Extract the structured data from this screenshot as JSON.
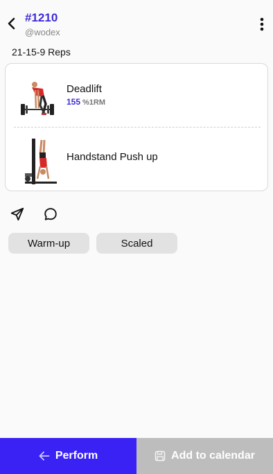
{
  "header": {
    "wod_id": "#1210",
    "author": "@wodex",
    "back_icon": "chevron-left-icon",
    "more_icon": "kebab-menu-icon"
  },
  "workout": {
    "scheme": "21-15-9 Reps",
    "exercises": [
      {
        "name": "Deadlift",
        "weight_value": "155",
        "weight_unit": "%1RM",
        "image": "deadlift-illustration"
      },
      {
        "name": "Handstand Push up",
        "image": "handstand-pushup-illustration"
      }
    ]
  },
  "actions": {
    "share_icon": "send-icon",
    "comment_icon": "comment-icon"
  },
  "tags": [
    "Warm-up",
    "Scaled"
  ],
  "footer": {
    "perform_label": "Perform",
    "calendar_label": "Add to calendar"
  },
  "colors": {
    "accent": "#3d2bd9",
    "perform_bg": "#3a22f5",
    "calendar_bg": "#bdbdbd",
    "chip_bg": "#e2e2e2"
  }
}
